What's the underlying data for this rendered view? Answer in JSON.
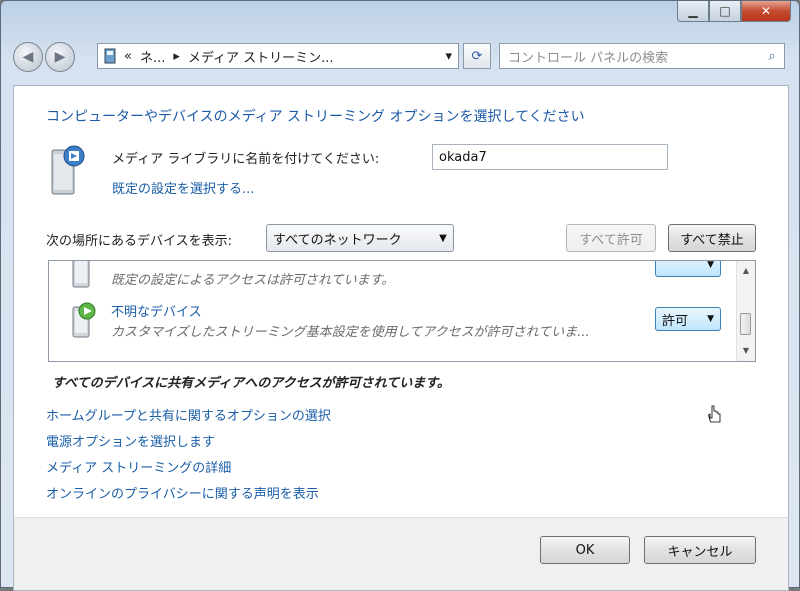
{
  "window": {
    "caption_min": "▁",
    "caption_max": "□",
    "caption_close": "✕"
  },
  "nav": {
    "back_icon": "◀",
    "forward_icon": "▶",
    "breadcrumb": [
      "«",
      "ネ...",
      "▸",
      "メディア ストリーミン..."
    ],
    "dropdown_arrow": "▾",
    "refresh_icon": "⟳",
    "search_placeholder": "コントロール パネルの検索",
    "search_icon": "⌕"
  },
  "main": {
    "heading": "コンピューターやデバイスのメディア ストリーミング オプションを選択してください",
    "library_label": "メディア ライブラリに名前を付けてください:",
    "library_name": "okada7",
    "default_settings_link": "既定の設定を選択する...",
    "show_devices_label": "次の場所にあるデバイスを表示:",
    "network_select": "すべてのネットワーク",
    "allow_all": "すべて許可",
    "block_all": "すべて禁止",
    "devices": [
      {
        "name": "",
        "desc": "既定の設定によるアクセスは許可されています。",
        "button": ""
      },
      {
        "name": "不明なデバイス",
        "desc": "カスタマイズしたストリーミング基本設定を使用してアクセスが許可されていま...",
        "button": "許可"
      }
    ],
    "status": "すべてのデバイスに共有メディアへのアクセスが許可されています。",
    "links": [
      "ホームグループと共有に関するオプションの選択",
      "電源オプションを選択します",
      "メディア ストリーミングの詳細",
      "オンラインのプライバシーに関する声明を表示"
    ]
  },
  "footer": {
    "ok": "OK",
    "cancel": "キャンセル"
  }
}
